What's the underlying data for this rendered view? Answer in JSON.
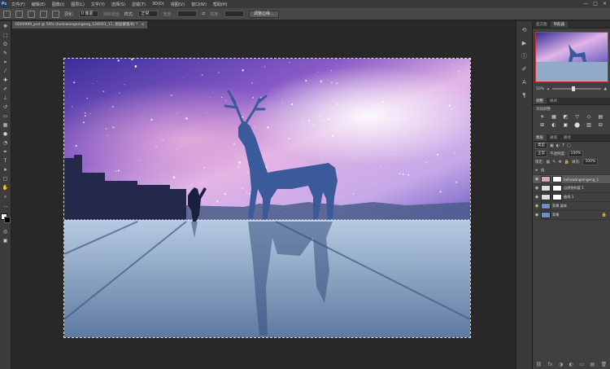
{
  "app": {
    "logo": "Ps"
  },
  "menu": [
    "文件(F)",
    "编辑(E)",
    "图像(I)",
    "图层(L)",
    "文字(Y)",
    "选择(S)",
    "滤镜(T)",
    "3D(D)",
    "视图(V)",
    "窗口(W)",
    "帮助(H)"
  ],
  "window_controls": [
    "—",
    "□",
    "✕"
  ],
  "options": {
    "feather_label": "羽化:",
    "feather_value": "0 像素",
    "antialias_label": "消除锯齿",
    "style_label": "样式:",
    "style_value": "正常",
    "width_label": "宽度:",
    "height_label": "高度:",
    "refine_button": "调整边缘..."
  },
  "document": {
    "tab_title": "0000999_psd @ 50% (heliowangeingeng_126001_11, 图层蒙版/8) *",
    "close": "×"
  },
  "panels": {
    "navigator_tabs": [
      "直方图",
      "导航器"
    ],
    "zoom_value": "50%",
    "adjust_tabs": [
      "调整",
      "样式"
    ],
    "adjust_label": "添加调整",
    "adjust_icons_row1": [
      "☀",
      "▦",
      "◩",
      "▽",
      "◇",
      "▤"
    ],
    "adjust_icons_row2": [
      "⊞",
      "◐",
      "▣",
      "⬤",
      "▥",
      "⊟"
    ],
    "layers_tabs": [
      "图层",
      "通道",
      "路径"
    ],
    "kind_label": "类型",
    "blend_mode": "正常",
    "opacity_label": "不透明度:",
    "opacity_value": "100%",
    "lock_label": "锁定:",
    "fill_label": "填充:",
    "fill_value": "100%",
    "group_label": "组",
    "layers": [
      {
        "name": "heliowangeingeng_1",
        "selected": true
      },
      {
        "name": "自然饱和度 1",
        "selected": false
      },
      {
        "name": "曲线 1",
        "selected": false
      },
      {
        "name": "背景 副本",
        "selected": false
      },
      {
        "name": "背景",
        "selected": false
      }
    ],
    "footer_icons": [
      "⛓",
      "fx",
      "◑",
      "◐",
      "▭",
      "▤",
      "🗑"
    ]
  },
  "colors": {
    "accent": "#c33333",
    "sky_top": "#2f2b8f",
    "sky_pink": "#e0a8e0",
    "floor": "#9fb8d4"
  }
}
